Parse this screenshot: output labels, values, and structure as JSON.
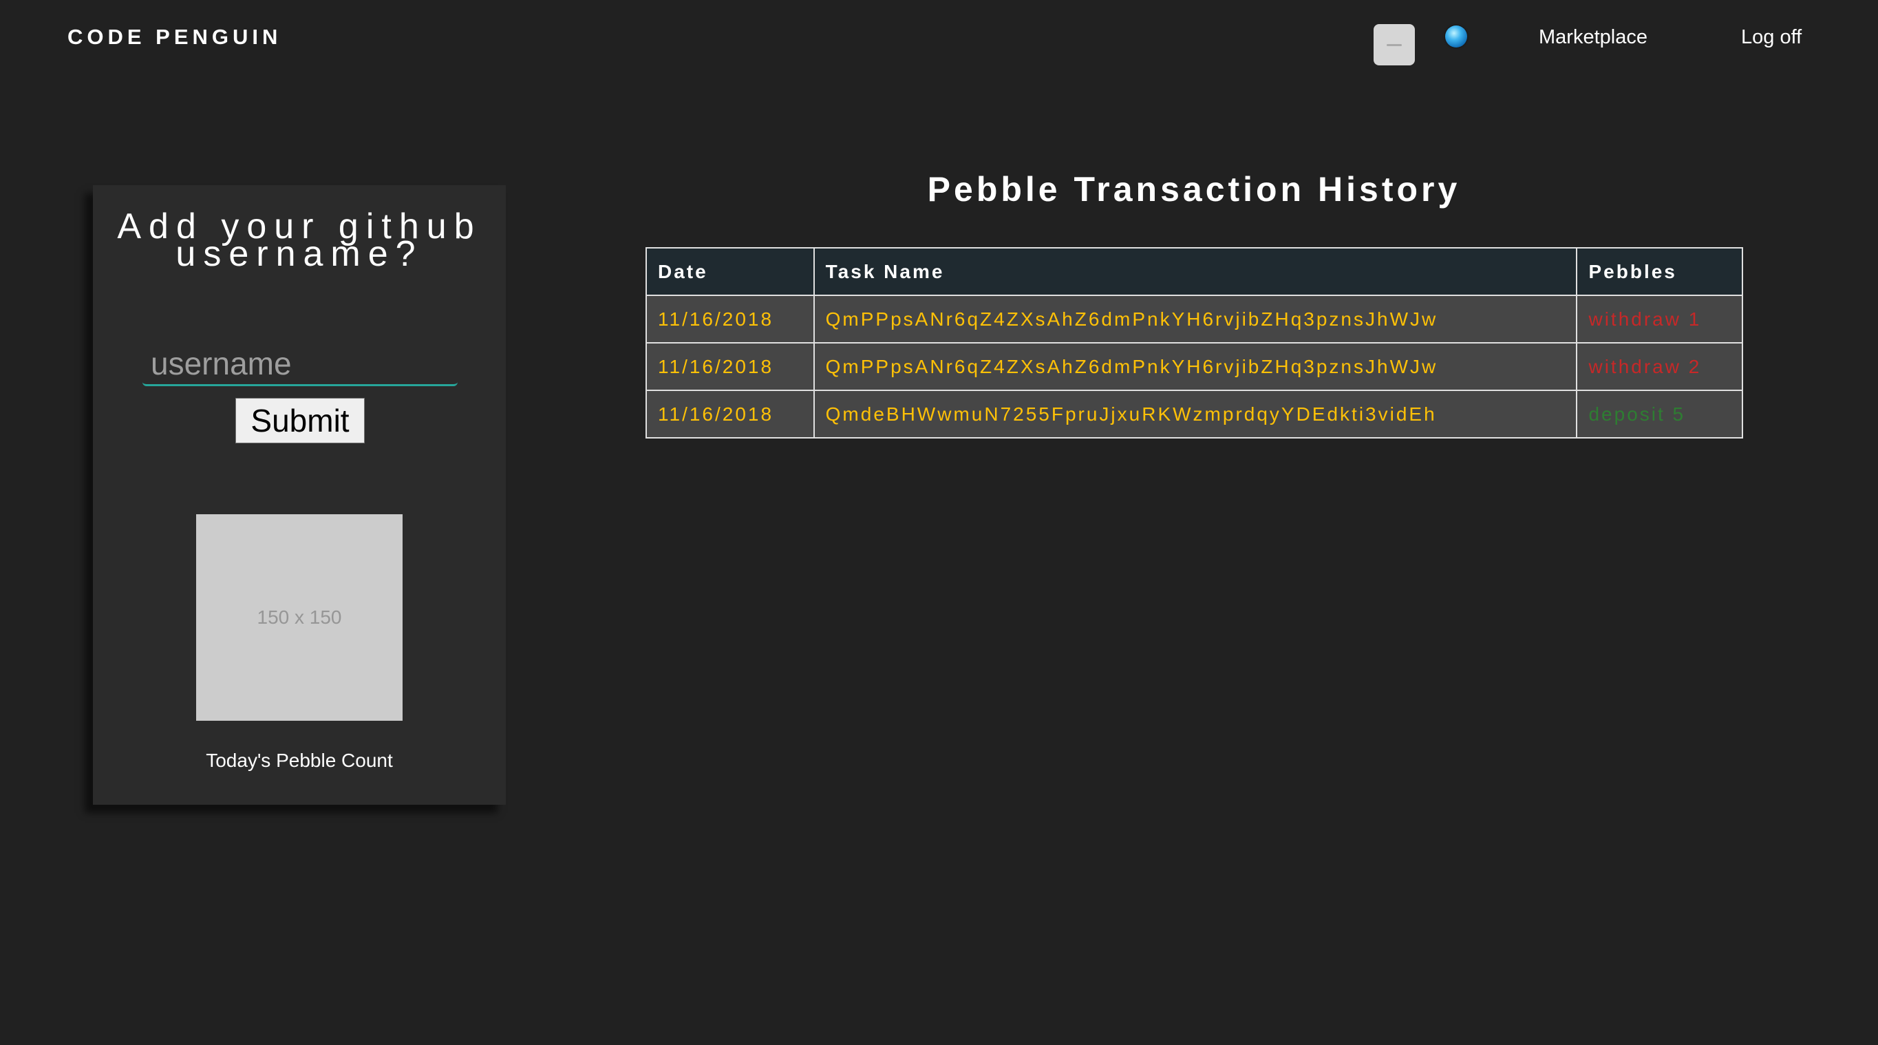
{
  "header": {
    "brand": "CODE PENGUIN",
    "nav": {
      "marketplace": "Marketplace",
      "logoff": "Log off"
    }
  },
  "card": {
    "heading": "Add your github username?",
    "input_placeholder": "username",
    "input_value": "",
    "submit_label": "Submit",
    "image_placeholder": "150 x 150",
    "pebble_count_label": "Today's Pebble Count"
  },
  "history": {
    "title": "Pebble Transaction History",
    "columns": [
      "Date",
      "Task Name",
      "Pebbles"
    ],
    "rows": [
      {
        "date": "11/16/2018",
        "task": "QmPPpsANr6qZ4ZXsAhZ6dmPnkYH6rvjibZHq3pznsJhWJw",
        "pebbles": "withdraw 1"
      },
      {
        "date": "11/16/2018",
        "task": "QmPPpsANr6qZ4ZXsAhZ6dmPnkYH6rvjibZHq3pznsJhWJw",
        "pebbles": "withdraw 2"
      },
      {
        "date": "11/16/2018",
        "task": "QmdeBHWwmuN7255FpruJjxuRKWzmprdqyYDEdkti3vidEh",
        "pebbles": "deposit 5"
      }
    ]
  },
  "colors": {
    "background": "#212121",
    "card": "#2b2b2b",
    "accent_underline": "#26a69a",
    "cell_text": "#ffc107",
    "withdraw": "#c62828",
    "deposit": "#2e7d32"
  },
  "icons": {
    "nav_toggle": "menu-icon",
    "globe": "globe-icon"
  }
}
